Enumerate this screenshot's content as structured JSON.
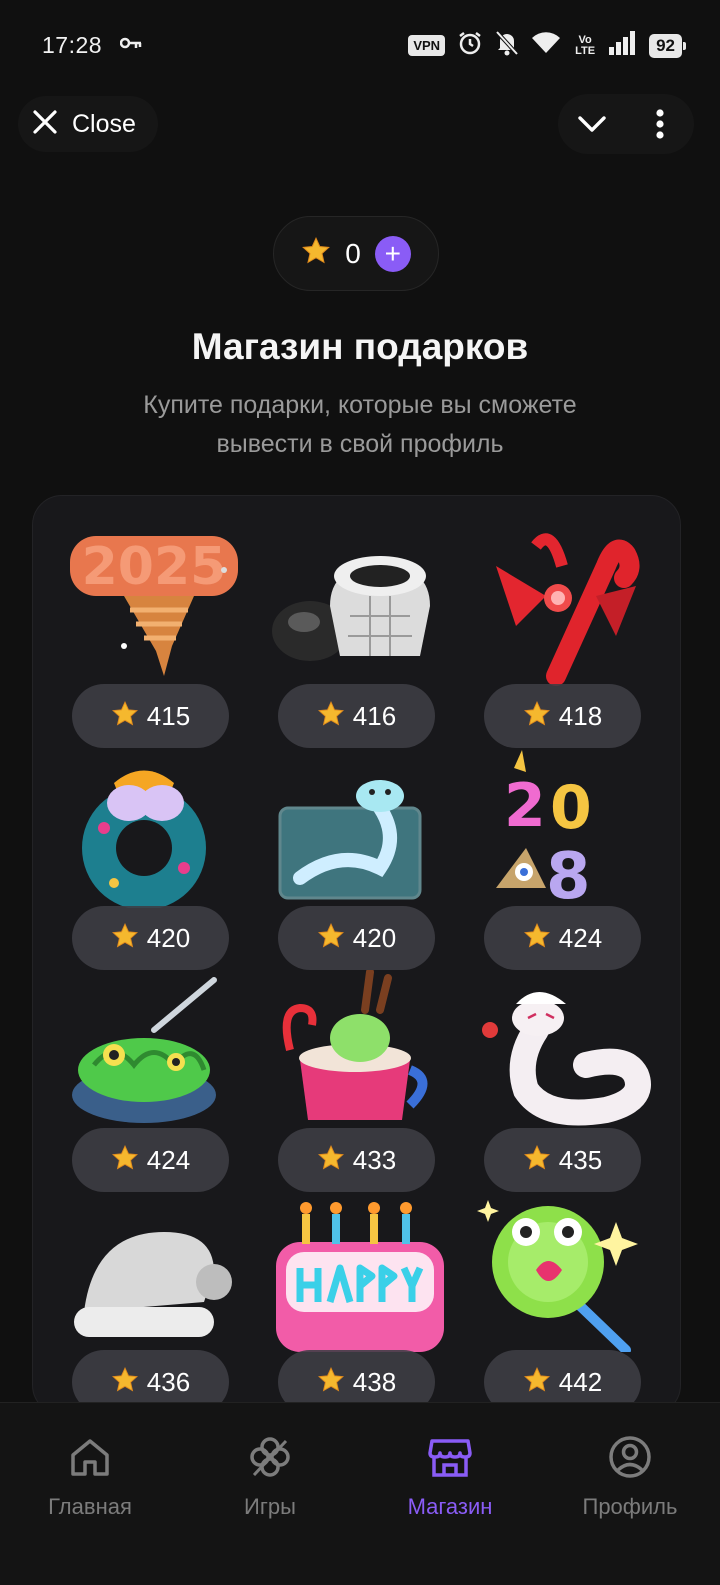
{
  "status_bar": {
    "time": "17:28",
    "vpn": "VPN",
    "volte": "Vo LTE",
    "battery": "92",
    "icons": [
      "key-icon",
      "alarm-icon",
      "bell-off-icon",
      "wifi-icon",
      "signal-icon"
    ]
  },
  "header": {
    "close_label": "Close",
    "icons": [
      "close-icon",
      "chevron-down-icon",
      "more-vertical-icon"
    ]
  },
  "balance": {
    "value": "0",
    "icons": [
      "star-icon",
      "plus-icon"
    ]
  },
  "title": "Магазин подарков",
  "subtitle": "Купите подарки, которые вы сможете вывести в свой профиль",
  "gifts": [
    {
      "price": "415",
      "art": "2025-tornado"
    },
    {
      "price": "416",
      "art": "spider-web-hat"
    },
    {
      "price": "418",
      "art": "candy-cane-bow"
    },
    {
      "price": "420",
      "art": "christmas-wreath"
    },
    {
      "price": "420",
      "art": "snake-aquarium"
    },
    {
      "price": "424",
      "art": "unicorn-2018"
    },
    {
      "price": "424",
      "art": "monster-pasta"
    },
    {
      "price": "433",
      "art": "cocoa-mug"
    },
    {
      "price": "435",
      "art": "white-snake"
    },
    {
      "price": "436",
      "art": "santa-hat"
    },
    {
      "price": "438",
      "art": "happy-birthday-cake"
    },
    {
      "price": "442",
      "art": "frog-lollipop"
    }
  ],
  "nav": [
    {
      "label": "Главная",
      "icon": "home-icon",
      "active": false
    },
    {
      "label": "Игры",
      "icon": "clover-icon",
      "active": false
    },
    {
      "label": "Магазин",
      "icon": "store-icon",
      "active": true
    },
    {
      "label": "Профиль",
      "icon": "profile-icon",
      "active": false
    }
  ],
  "colors": {
    "accent": "#8a5cf6",
    "star": "#f5b82e",
    "background": "#101010"
  }
}
